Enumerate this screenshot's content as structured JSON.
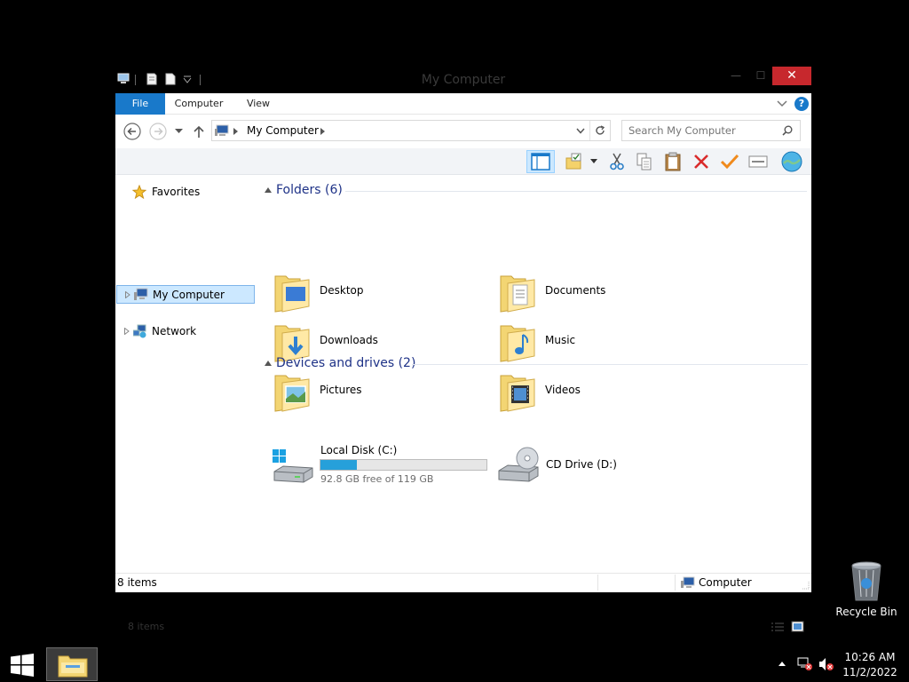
{
  "window": {
    "title": "My Computer",
    "controls": {
      "minimize": "—",
      "maximize": "☐",
      "close": "✕"
    }
  },
  "ribbon": {
    "tabs": [
      "File",
      "Computer",
      "View"
    ]
  },
  "navigation": {
    "address_path": "My Computer",
    "search_placeholder": "Search My Computer"
  },
  "nav_pane": {
    "items": [
      {
        "label": "Favorites",
        "icon": "star-icon",
        "selected": false
      },
      {
        "label": "My Computer",
        "icon": "computer-icon",
        "selected": true
      },
      {
        "label": "Network",
        "icon": "network-icon",
        "selected": false
      }
    ]
  },
  "groups": {
    "folders": {
      "header": "Folders (6)",
      "items": [
        {
          "label": "Desktop",
          "icon": "desktop-folder-icon"
        },
        {
          "label": "Documents",
          "icon": "documents-folder-icon"
        },
        {
          "label": "Downloads",
          "icon": "downloads-folder-icon"
        },
        {
          "label": "Music",
          "icon": "music-folder-icon"
        },
        {
          "label": "Pictures",
          "icon": "pictures-folder-icon"
        },
        {
          "label": "Videos",
          "icon": "videos-folder-icon"
        }
      ]
    },
    "drives": {
      "header": "Devices and drives (2)",
      "items": [
        {
          "label": "Local Disk (C:)",
          "free_text": "92.8 GB free of 119 GB",
          "used_fraction": 0.22,
          "icon": "local-disk-icon"
        },
        {
          "label": "CD Drive (D:)",
          "icon": "cd-drive-icon"
        }
      ]
    }
  },
  "content_footer": {
    "item_count": "8 items"
  },
  "statusbar": {
    "item_count": "8 items",
    "location": "Computer"
  },
  "desktop": {
    "recycle_bin": "Recycle Bin"
  },
  "taskbar": {
    "time": "10:26 AM",
    "date": "11/2/2022"
  },
  "colors": {
    "accent": "#1979ca",
    "close_button": "#c7282d",
    "selection": "#cce8ff",
    "group_header": "#1e3287",
    "disk_bar": "#26a0da"
  }
}
